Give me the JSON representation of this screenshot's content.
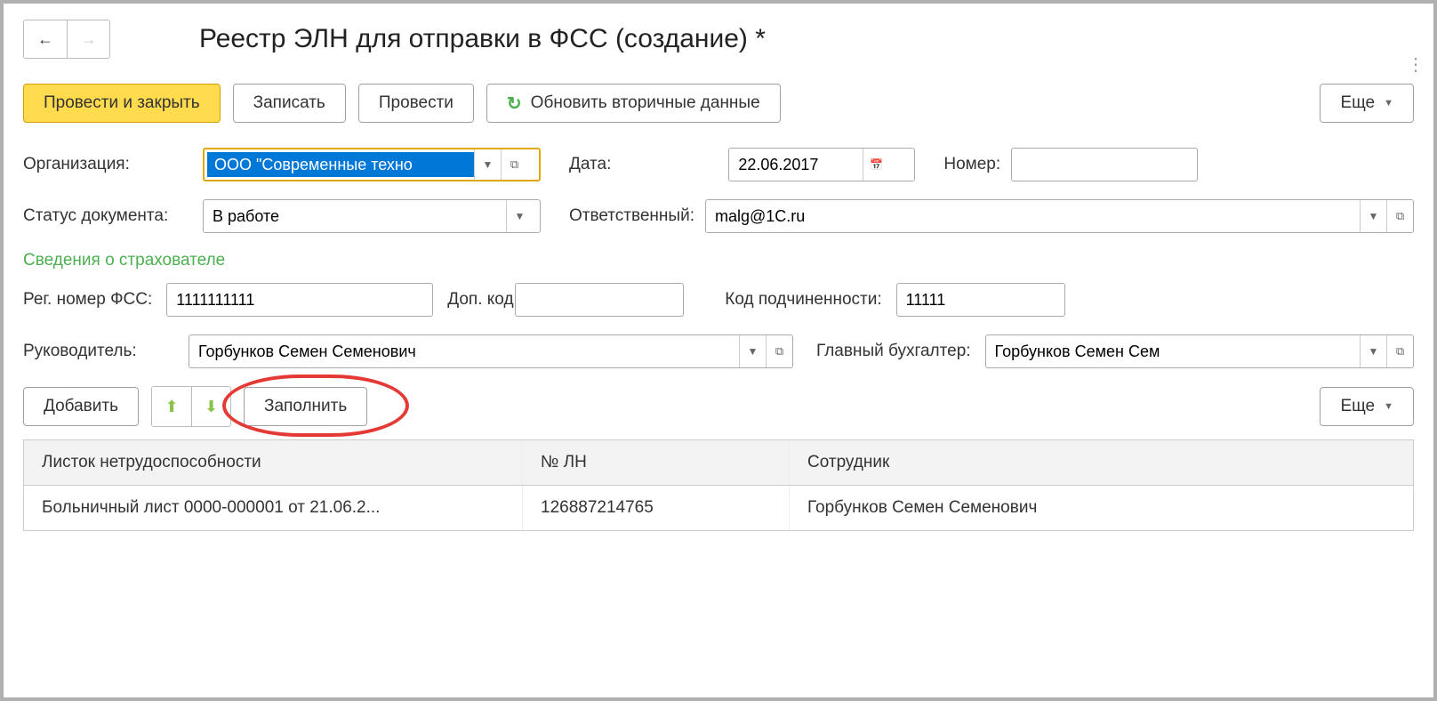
{
  "header": {
    "title": "Реестр ЭЛН для отправки в ФСС (создание) *"
  },
  "toolbar": {
    "post_and_close": "Провести и закрыть",
    "save": "Записать",
    "post": "Провести",
    "refresh_secondary": "Обновить вторичные данные",
    "more": "Еще"
  },
  "form": {
    "organization_label": "Организация:",
    "organization_value": "ООО \"Современные техно",
    "date_label": "Дата:",
    "date_value": "22.06.2017",
    "number_label": "Номер:",
    "number_value": "",
    "status_label": "Статус документа:",
    "status_value": "В работе",
    "responsible_label": "Ответственный:",
    "responsible_value": "malg@1C.ru"
  },
  "insurer": {
    "section_title": "Сведения о страхователе",
    "reg_num_label": "Рег. номер ФСС:",
    "reg_num_value": "1111111111",
    "ext_code_label": "Доп. код:",
    "ext_code_value": "",
    "sub_code_label": "Код подчиненности:",
    "sub_code_value": "11111",
    "manager_label": "Руководитель:",
    "manager_value": "Горбунков Семен Семенович",
    "accountant_label": "Главный бухгалтер:",
    "accountant_value": "Горбунков Семен Сем"
  },
  "table_toolbar": {
    "add": "Добавить",
    "fill": "Заполнить",
    "more": "Еще"
  },
  "table": {
    "headers": {
      "col1": "Листок нетрудоспособности",
      "col2": "№ ЛН",
      "col3": "Сотрудник"
    },
    "rows": [
      {
        "col1": "Больничный лист 0000-000001 от 21.06.2...",
        "col2": "126887214765",
        "col3": "Горбунков Семен Семенович"
      }
    ]
  }
}
